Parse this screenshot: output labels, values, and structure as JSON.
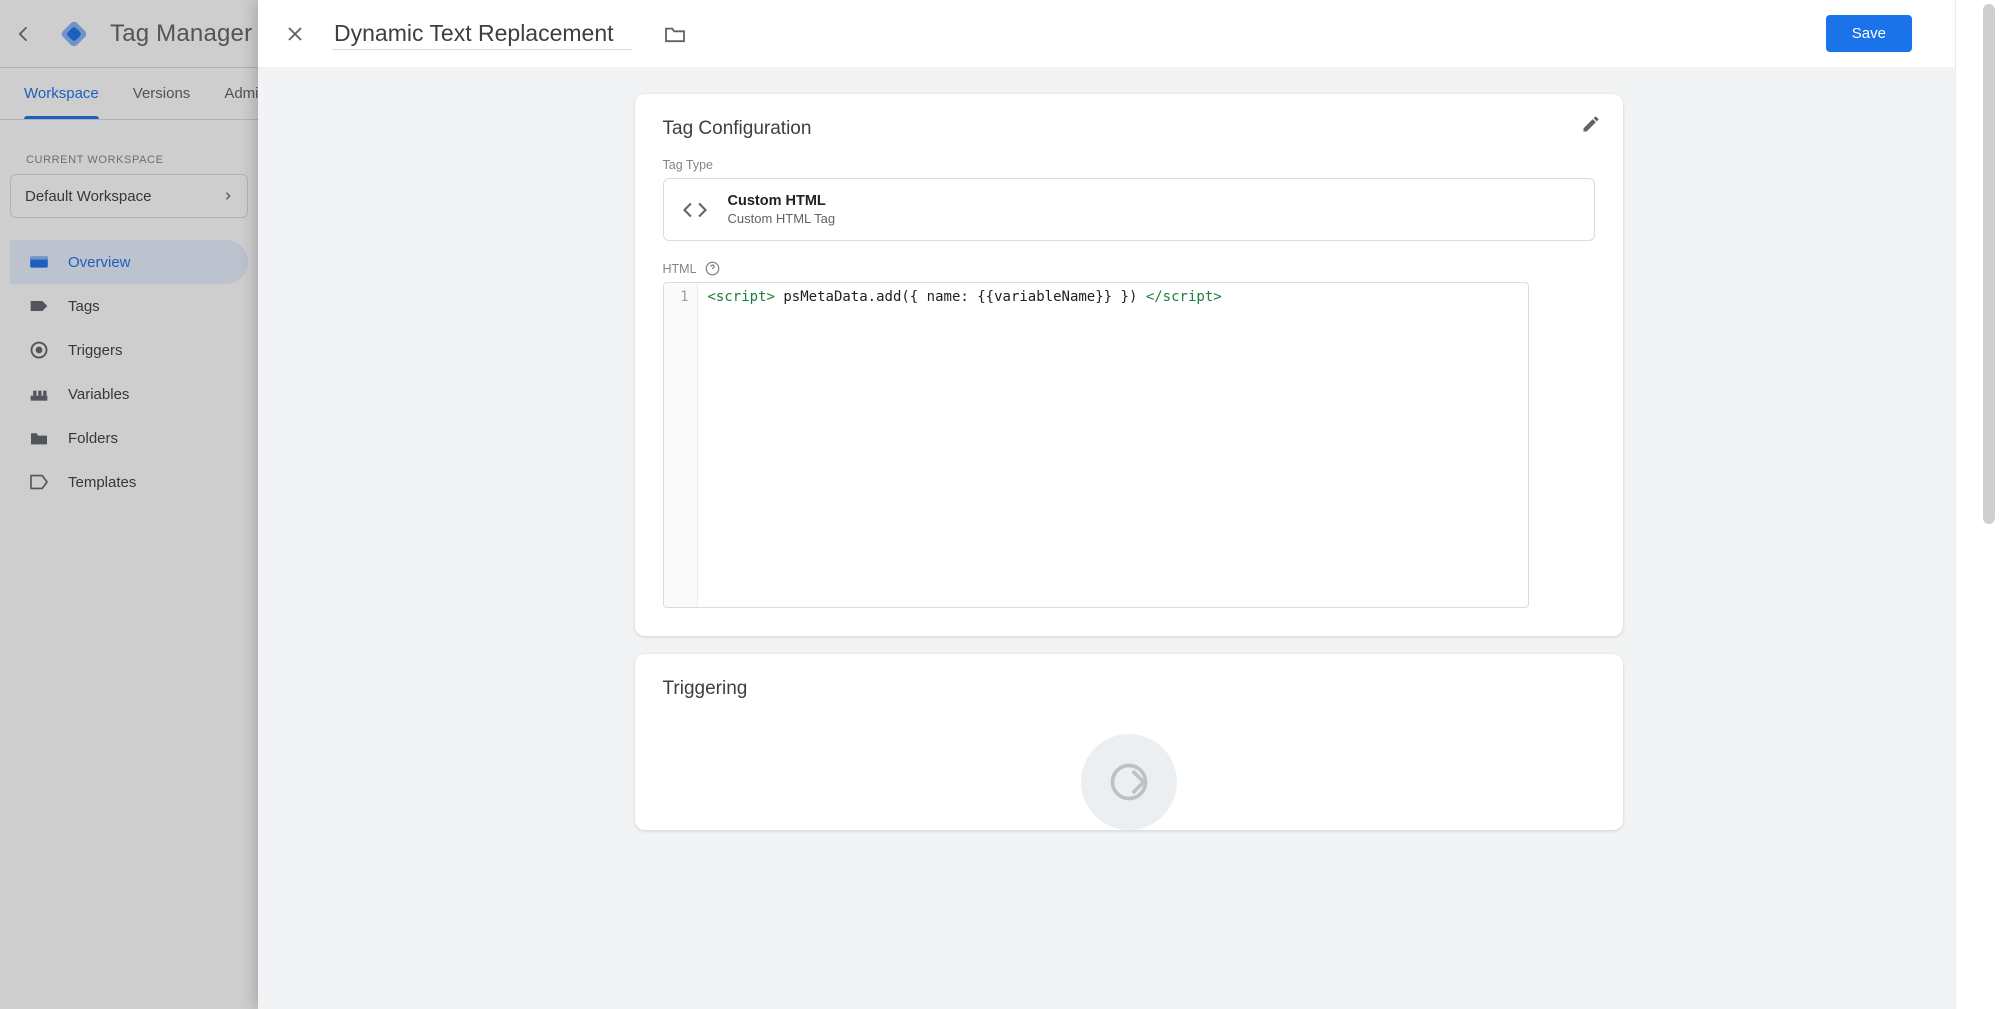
{
  "app": {
    "title": "Tag Manager",
    "tabs": [
      "Workspace",
      "Versions",
      "Admin"
    ],
    "active_tab": 0
  },
  "workspace": {
    "label": "CURRENT WORKSPACE",
    "selected": "Default Workspace"
  },
  "nav": {
    "items": [
      {
        "label": "Overview",
        "icon": "overview"
      },
      {
        "label": "Tags",
        "icon": "tag"
      },
      {
        "label": "Triggers",
        "icon": "trigger"
      },
      {
        "label": "Variables",
        "icon": "variable"
      },
      {
        "label": "Folders",
        "icon": "folder"
      },
      {
        "label": "Templates",
        "icon": "template"
      }
    ],
    "active": 0
  },
  "panel": {
    "tag_name": "Dynamic Text Replacement",
    "save_label": "Save"
  },
  "config": {
    "card_title": "Tag Configuration",
    "tag_type_label": "Tag Type",
    "type_name": "Custom HTML",
    "type_sub": "Custom HTML Tag",
    "html_label": "HTML",
    "code": {
      "line_no": "1",
      "open_tag": "<script>",
      "body": " psMetaData.add({ name: {{variableName}} }) ",
      "close_tag": "</script>"
    }
  },
  "triggering": {
    "card_title": "Triggering"
  }
}
